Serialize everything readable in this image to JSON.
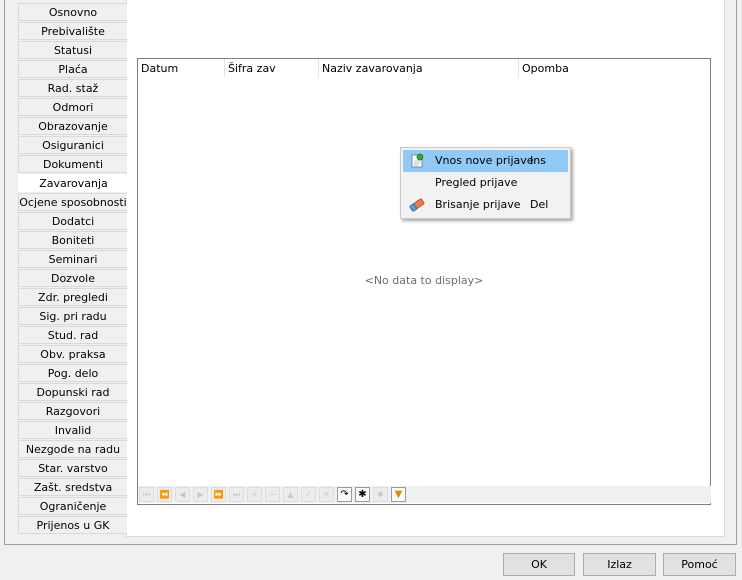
{
  "tabs": [
    {
      "label": "Osnovno",
      "active": false
    },
    {
      "label": "Prebivalište",
      "active": false
    },
    {
      "label": "Statusi",
      "active": false
    },
    {
      "label": "Plaća",
      "active": false
    },
    {
      "label": "Rad. staž",
      "active": false
    },
    {
      "label": "Odmori",
      "active": false
    },
    {
      "label": "Obrazovanje",
      "active": false
    },
    {
      "label": "Osiguranici",
      "active": false
    },
    {
      "label": "Dokumenti",
      "active": false
    },
    {
      "label": "Zavarovanja",
      "active": true
    },
    {
      "label": "Ocjene sposobnosti",
      "active": false
    },
    {
      "label": "Dodatci",
      "active": false
    },
    {
      "label": "Boniteti",
      "active": false
    },
    {
      "label": "Seminari",
      "active": false
    },
    {
      "label": "Dozvole",
      "active": false
    },
    {
      "label": "Zdr. pregledi",
      "active": false
    },
    {
      "label": "Sig. pri radu",
      "active": false
    },
    {
      "label": "Stud. rad",
      "active": false
    },
    {
      "label": "Obv. praksa",
      "active": false
    },
    {
      "label": "Pog. delo",
      "active": false
    },
    {
      "label": "Dopunski rad",
      "active": false
    },
    {
      "label": "Razgovori",
      "active": false
    },
    {
      "label": "Invalid",
      "active": false
    },
    {
      "label": "Nezgode na radu",
      "active": false
    },
    {
      "label": "Star. varstvo",
      "active": false
    },
    {
      "label": "Zašt. sredstva",
      "active": false
    },
    {
      "label": "Ograničenje",
      "active": false
    },
    {
      "label": "Prijenos u GK",
      "active": false
    }
  ],
  "grid": {
    "columns": [
      "Datum",
      "Šifra zav",
      "Naziv zavarovanja",
      "Opomba"
    ],
    "empty_text": "<No data to display>"
  },
  "navigator": [
    {
      "name": "first",
      "glyph": "⏮",
      "enabled": false
    },
    {
      "name": "prev-page",
      "glyph": "⏪",
      "enabled": false
    },
    {
      "name": "prev",
      "glyph": "◀",
      "enabled": false
    },
    {
      "name": "next",
      "glyph": "▶",
      "enabled": false
    },
    {
      "name": "next-page",
      "glyph": "⏩",
      "enabled": false
    },
    {
      "name": "last",
      "glyph": "⏭",
      "enabled": false
    },
    {
      "name": "insert",
      "glyph": "+",
      "enabled": false
    },
    {
      "name": "delete",
      "glyph": "−",
      "enabled": false
    },
    {
      "name": "edit",
      "glyph": "▲",
      "enabled": false
    },
    {
      "name": "post",
      "glyph": "✓",
      "enabled": false
    },
    {
      "name": "cancel",
      "glyph": "✕",
      "enabled": false
    },
    {
      "name": "refresh",
      "glyph": "↷",
      "enabled": true
    },
    {
      "name": "bookmark",
      "glyph": "✱",
      "enabled": true
    },
    {
      "name": "goto-bookmark",
      "glyph": "✱",
      "enabled": false
    },
    {
      "name": "filter",
      "glyph": "▼",
      "enabled": true
    }
  ],
  "context_menu": {
    "items": [
      {
        "label": "Vnos nove prijave",
        "shortcut": "Ins",
        "icon": "new-document-icon",
        "highlighted": true
      },
      {
        "label": "Pregled prijave",
        "shortcut": "",
        "icon": "",
        "highlighted": false
      },
      {
        "label": "Brisanje prijave",
        "shortcut": "Del",
        "icon": "eraser-icon",
        "highlighted": false
      }
    ]
  },
  "buttons": {
    "ok": "OK",
    "exit": "Izlaz",
    "help": "Pomoć"
  }
}
